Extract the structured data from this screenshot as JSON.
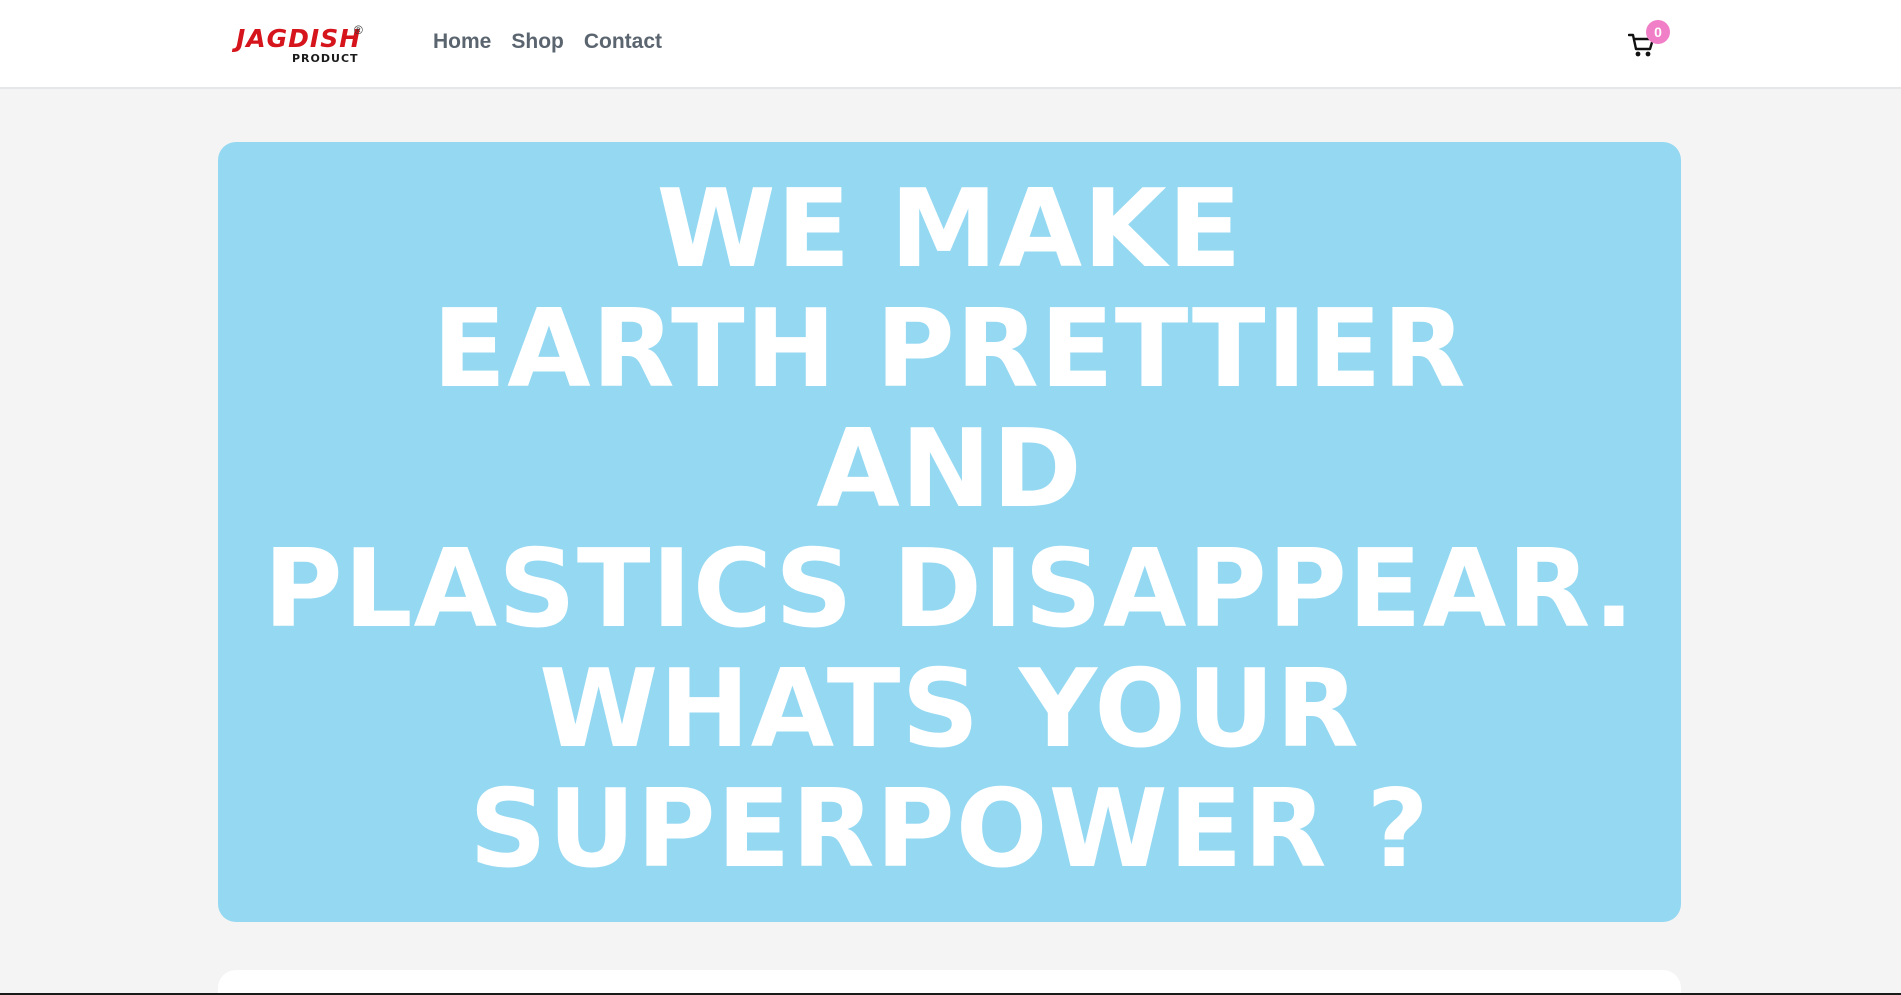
{
  "brand": {
    "name": "JAGDISH",
    "registered_mark": "®",
    "tagline": "PRODUCT",
    "color": "#d5141b"
  },
  "nav": {
    "items": [
      {
        "label": "Home"
      },
      {
        "label": "Shop"
      },
      {
        "label": "Contact"
      }
    ]
  },
  "cart": {
    "icon": "shopping-cart-icon",
    "count": "0",
    "badge_color": "#f07fc8"
  },
  "hero": {
    "background": "#95d8f2",
    "lines": [
      "WE MAKE",
      "EARTH PRETTIER",
      "AND",
      "PLASTICS DISAPPEAR.",
      "WHATS YOUR",
      "SUPERPOWER ?"
    ]
  }
}
